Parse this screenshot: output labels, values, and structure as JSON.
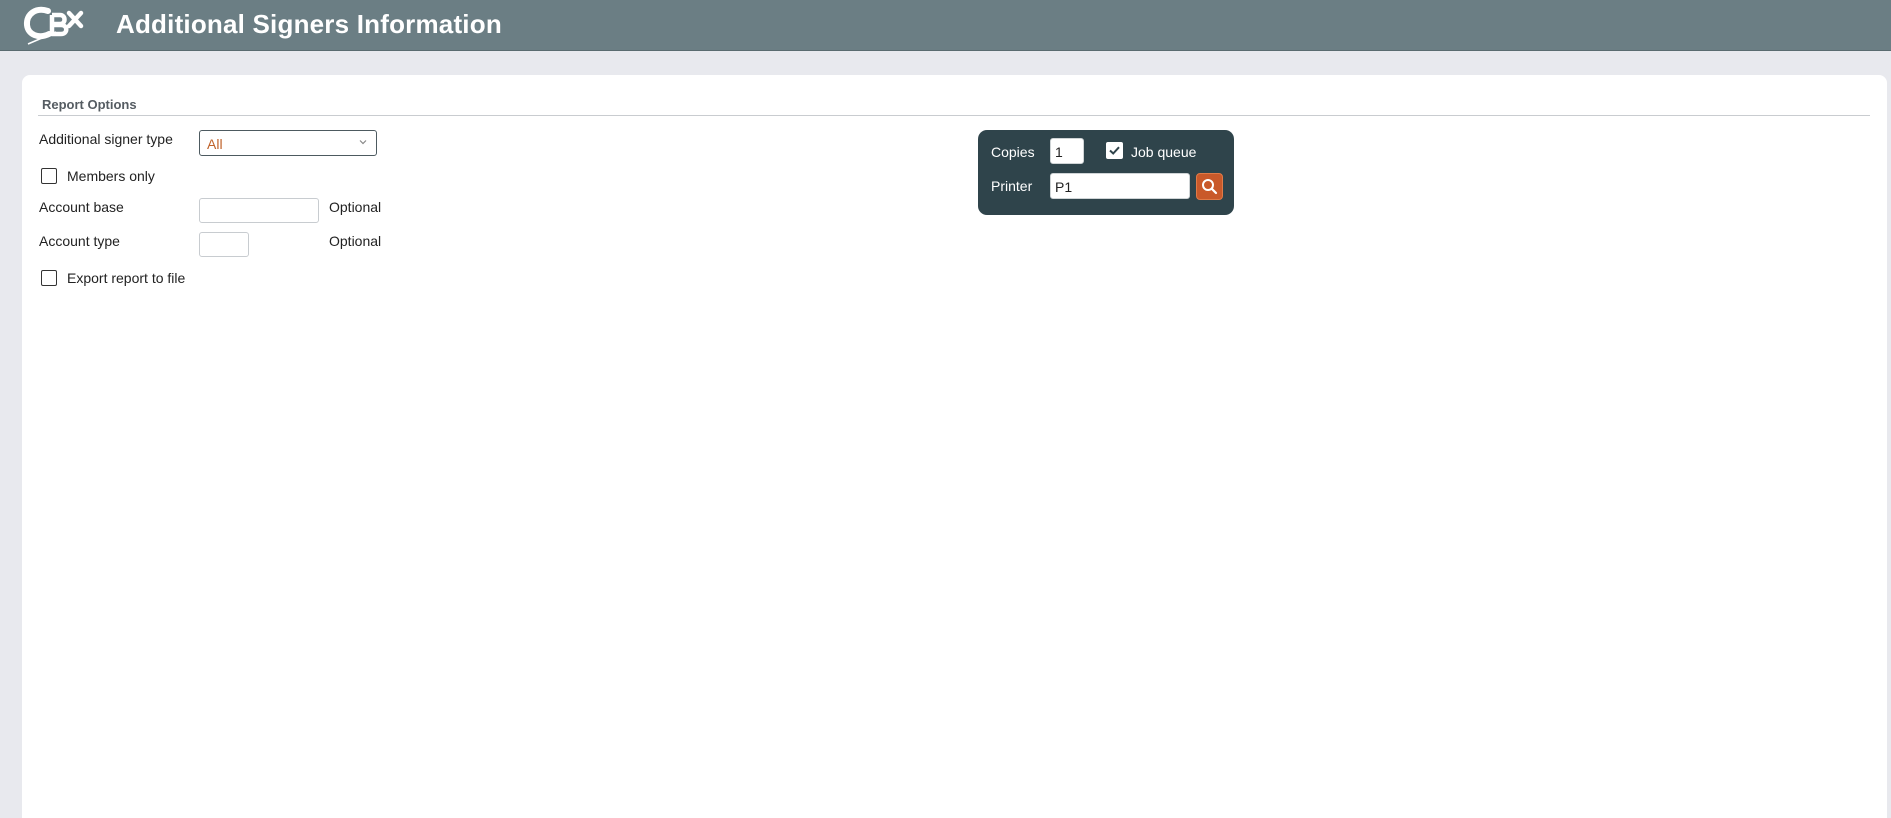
{
  "header": {
    "title": "Additional Signers Information",
    "logo_text": "CBX"
  },
  "report_options": {
    "section_title": "Report Options",
    "signer_type": {
      "label": "Additional signer type",
      "selected": "All"
    },
    "members_only": {
      "label": "Members only",
      "checked": false
    },
    "account_base": {
      "label": "Account base",
      "value": "",
      "hint": "Optional"
    },
    "account_type": {
      "label": "Account type",
      "value": "",
      "hint": "Optional"
    },
    "export_to_file": {
      "label": "Export report to file",
      "checked": false
    }
  },
  "print_options": {
    "copies_label": "Copies",
    "copies_value": "1",
    "job_queue_label": "Job queue",
    "job_queue_checked": true,
    "printer_label": "Printer",
    "printer_value": "P1"
  },
  "colors": {
    "header": "#6b7e84",
    "print_box": "#2f444b",
    "accent": "#c9592a"
  }
}
